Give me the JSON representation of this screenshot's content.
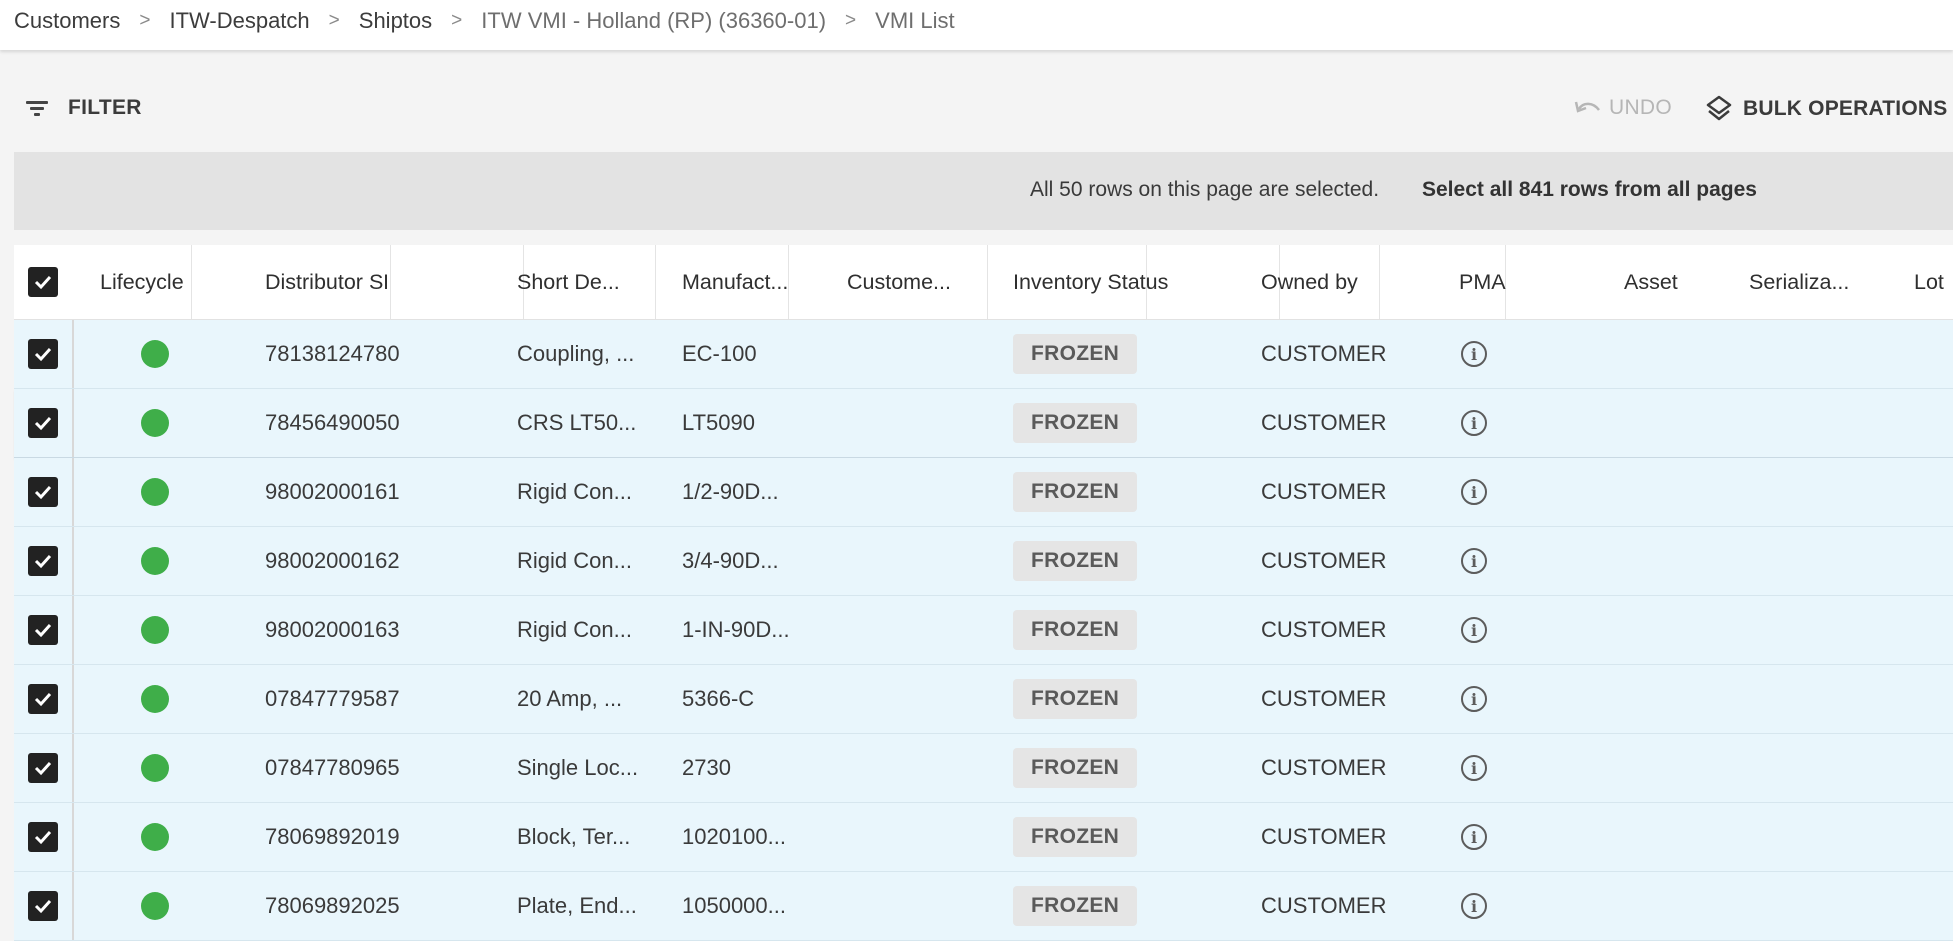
{
  "breadcrumb": [
    {
      "label": "Customers"
    },
    {
      "label": "ITW-Despatch"
    },
    {
      "label": "Shiptos"
    },
    {
      "label": "ITW VMI - Holland (RP) (36360-01)"
    },
    {
      "label": "VMI List"
    }
  ],
  "toolbar": {
    "filter_label": "FILTER",
    "undo_label": "UNDO",
    "bulk_label": "BULK OPERATIONS"
  },
  "selection": {
    "message": "All 50 rows on this page are selected.",
    "select_all_link": "Select all 841 rows from all pages"
  },
  "table": {
    "columns": [
      "Lifecycle ...",
      "Distributor SKU",
      "Short De...",
      "Manufact...",
      "Custome...",
      "Inventory Status",
      "Owned by",
      "PMA",
      "Asset",
      "Serializa...",
      "Lot"
    ],
    "rows": [
      {
        "sku": "78138124780",
        "short_desc": "Coupling, ...",
        "manufacturer": "EC-100",
        "status": "FROZEN",
        "owned_by": "CUSTOMER"
      },
      {
        "sku": "78456490050",
        "short_desc": "CRS LT50...",
        "manufacturer": "LT5090",
        "status": "FROZEN",
        "owned_by": "CUSTOMER"
      },
      {
        "sku": "98002000161",
        "short_desc": "Rigid Con...",
        "manufacturer": "1/2-90D...",
        "status": "FROZEN",
        "owned_by": "CUSTOMER"
      },
      {
        "sku": "98002000162",
        "short_desc": "Rigid Con...",
        "manufacturer": "3/4-90D...",
        "status": "FROZEN",
        "owned_by": "CUSTOMER"
      },
      {
        "sku": "98002000163",
        "short_desc": "Rigid Con...",
        "manufacturer": "1-IN-90D...",
        "status": "FROZEN",
        "owned_by": "CUSTOMER"
      },
      {
        "sku": "07847779587",
        "short_desc": "20 Amp, ...",
        "manufacturer": "5366-C",
        "status": "FROZEN",
        "owned_by": "CUSTOMER"
      },
      {
        "sku": "07847780965",
        "short_desc": "Single Loc...",
        "manufacturer": "2730",
        "status": "FROZEN",
        "owned_by": "CUSTOMER"
      },
      {
        "sku": "78069892019",
        "short_desc": "Block, Ter...",
        "manufacturer": "1020100...",
        "status": "FROZEN",
        "owned_by": "CUSTOMER"
      },
      {
        "sku": "78069892025",
        "short_desc": "Plate, End...",
        "manufacturer": "1050000...",
        "status": "FROZEN",
        "owned_by": "CUSTOMER"
      }
    ]
  },
  "colors": {
    "lifecycle_active": "#3fae49",
    "row_selected_bg": "#e9f6fc",
    "banner_bg": "#e3e3e3"
  },
  "icons": {
    "filter": "filter-lines-icon",
    "undo": "undo-arrow-icon",
    "bulk": "layers-icon",
    "pma": "info-circle-icon",
    "checkbox": "checkbox-checked-icon"
  }
}
